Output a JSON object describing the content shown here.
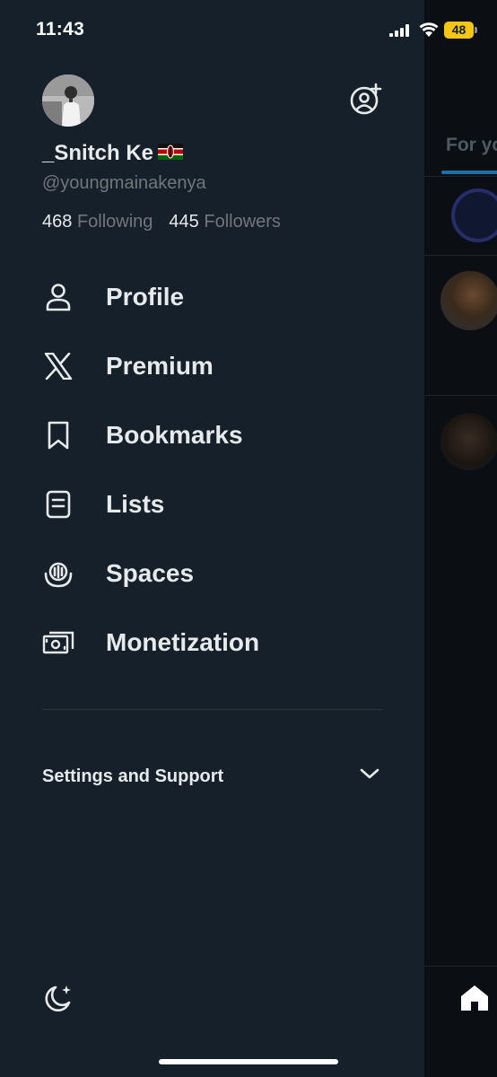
{
  "status_bar": {
    "time": "11:43",
    "battery": "48"
  },
  "profile": {
    "display_name": "_Snitch Ke",
    "handle": "@youngmainakenya",
    "following_count": "468",
    "following_label": "Following",
    "followers_count": "445",
    "followers_label": "Followers"
  },
  "menu": {
    "items": [
      {
        "label": "Profile",
        "icon": "person-icon"
      },
      {
        "label": "Premium",
        "icon": "x-logo-icon"
      },
      {
        "label": "Bookmarks",
        "icon": "bookmark-icon"
      },
      {
        "label": "Lists",
        "icon": "list-icon"
      },
      {
        "label": "Spaces",
        "icon": "spaces-microphone-icon"
      },
      {
        "label": "Monetization",
        "icon": "money-icon"
      }
    ]
  },
  "settings": {
    "label": "Settings and Support"
  },
  "background": {
    "tab_label": "For yo"
  },
  "colors": {
    "background": "#15202b",
    "accent": "#1d9bf0",
    "secondary_text": "#71767b",
    "battery": "#f5c518"
  }
}
